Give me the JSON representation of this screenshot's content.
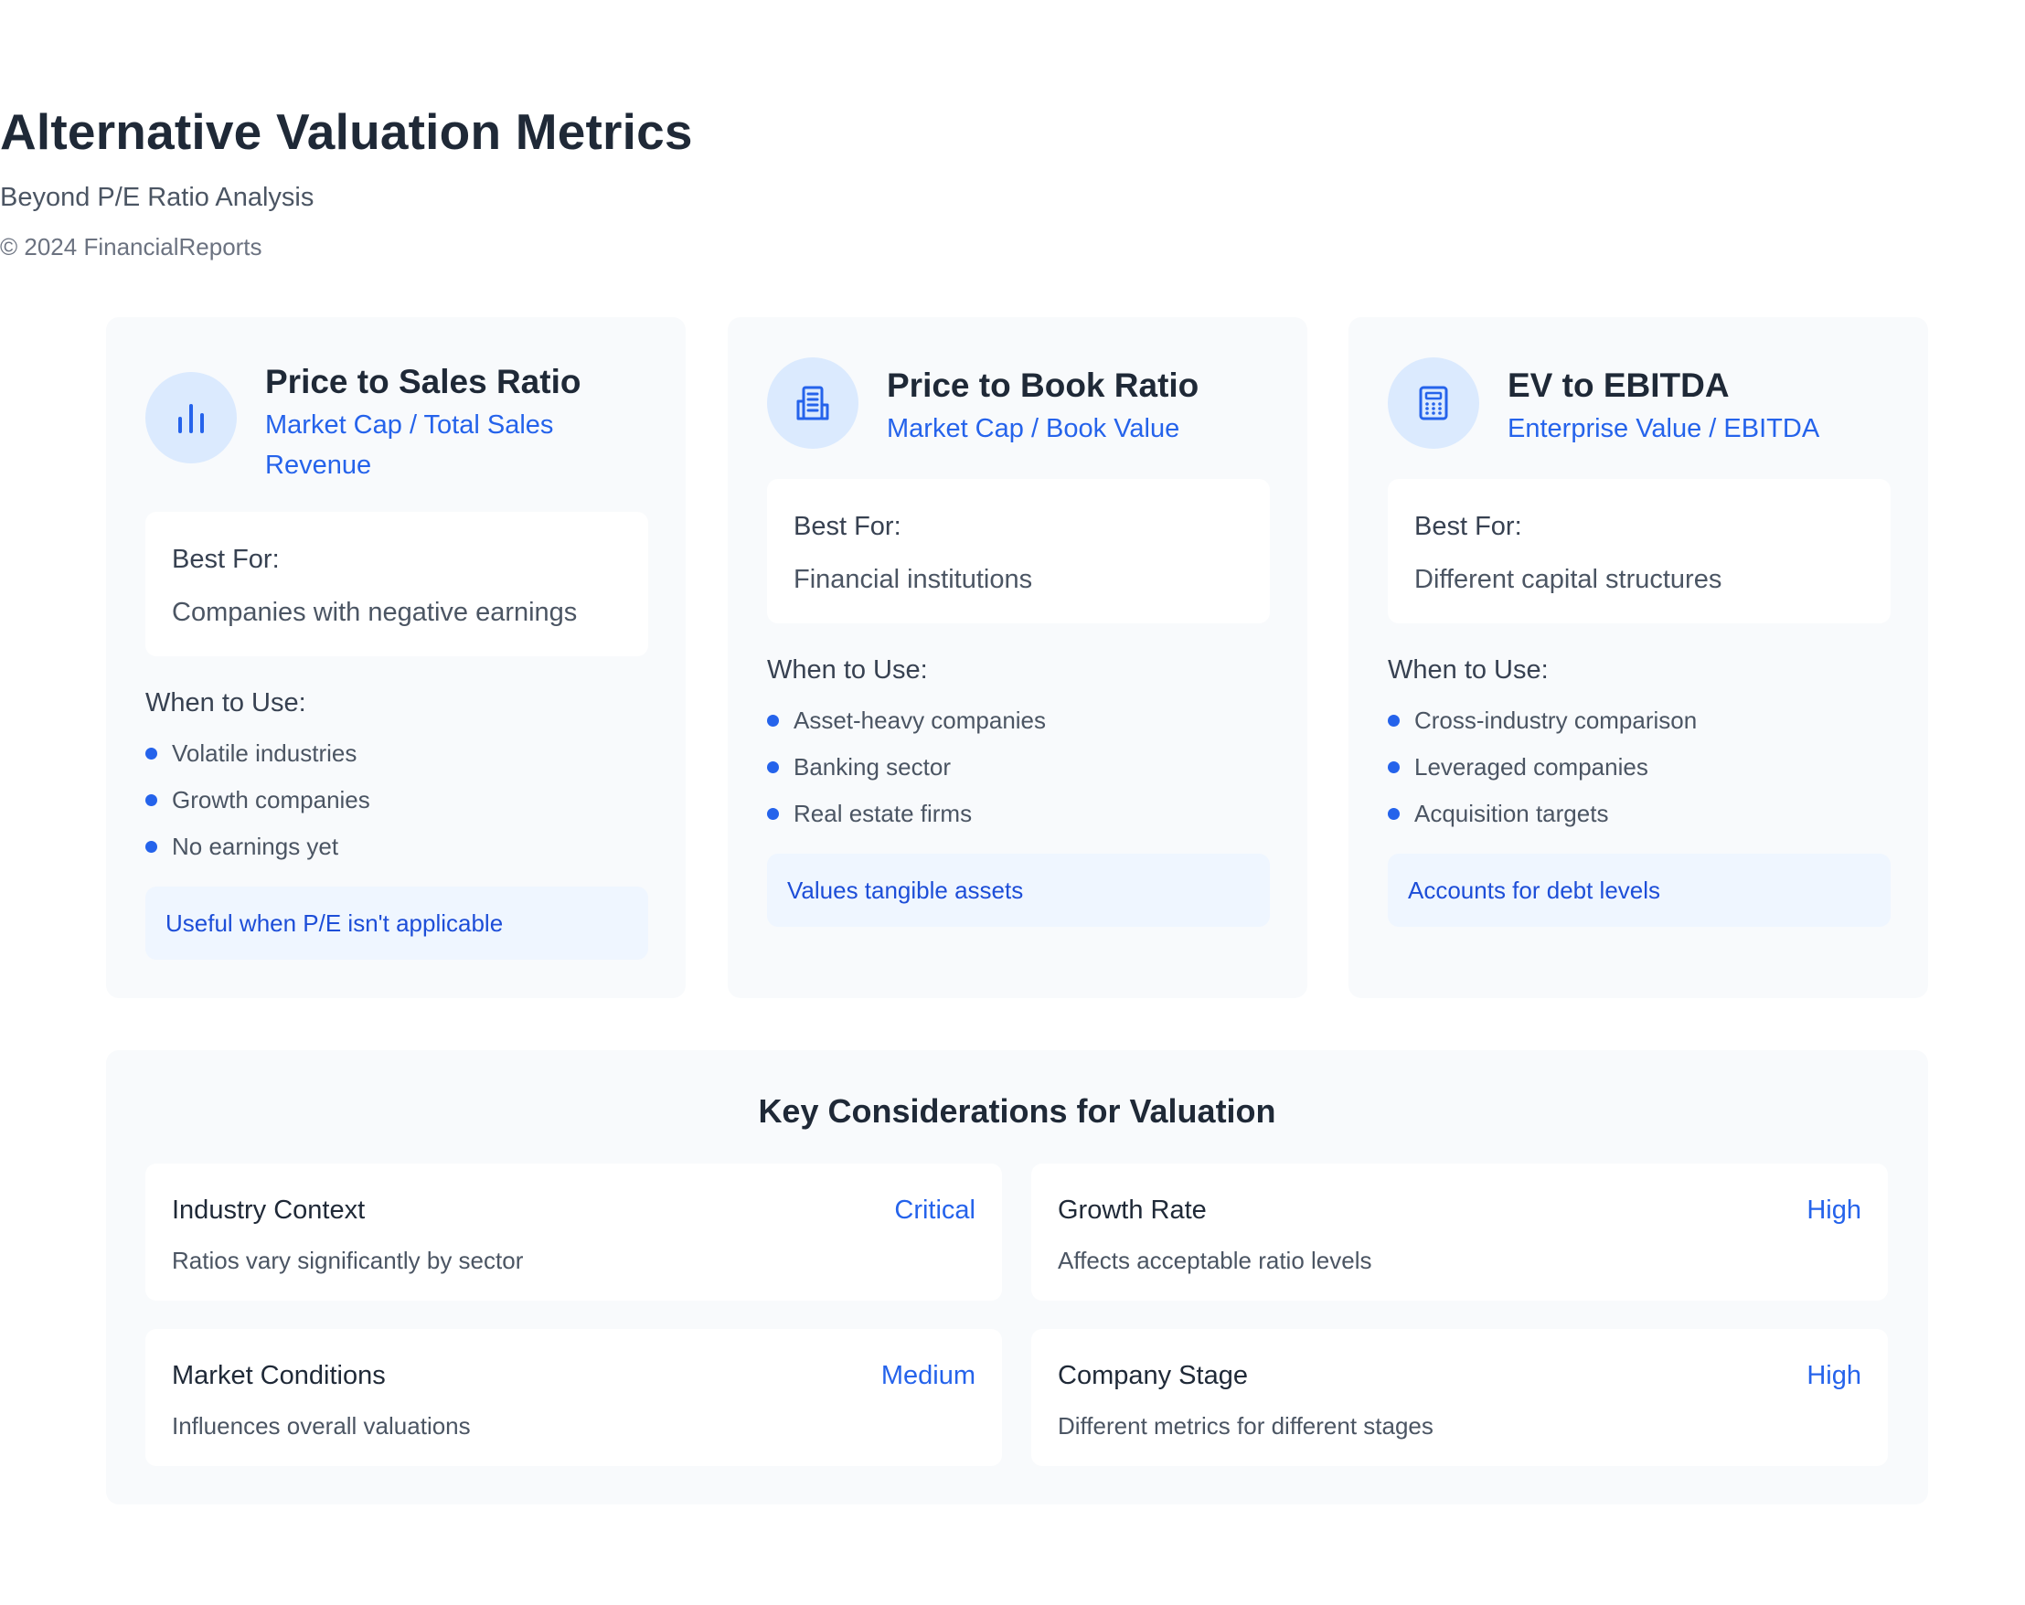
{
  "header": {
    "title": "Alternative Valuation Metrics",
    "subtitle": "Beyond P/E Ratio Analysis",
    "copyright": "© 2024 FinancialReports"
  },
  "metrics": [
    {
      "icon": "bar-chart-icon",
      "title": "Price to Sales Ratio",
      "formula": "Market Cap / Total Sales Revenue",
      "best_for_label": "Best For:",
      "best_for": "Companies with negative earnings",
      "when_label": "When to Use:",
      "uses": [
        "Volatile industries",
        "Growth companies",
        "No earnings yet"
      ],
      "note": "Useful when P/E isn't applicable"
    },
    {
      "icon": "building-icon",
      "title": "Price to Book Ratio",
      "formula": "Market Cap / Book Value",
      "best_for_label": "Best For:",
      "best_for": "Financial institutions",
      "when_label": "When to Use:",
      "uses": [
        "Asset-heavy companies",
        "Banking sector",
        "Real estate firms"
      ],
      "note": "Values tangible assets"
    },
    {
      "icon": "calculator-icon",
      "title": "EV to EBITDA",
      "formula": "Enterprise Value / EBITDA",
      "best_for_label": "Best For:",
      "best_for": "Different capital structures",
      "when_label": "When to Use:",
      "uses": [
        "Cross-industry comparison",
        "Leveraged companies",
        "Acquisition targets"
      ],
      "note": "Accounts for debt levels"
    }
  ],
  "considerations": {
    "title": "Key Considerations for Valuation",
    "items": [
      {
        "name": "Industry Context",
        "level": "Critical",
        "desc": "Ratios vary significantly by sector"
      },
      {
        "name": "Growth Rate",
        "level": "High",
        "desc": "Affects acceptable ratio levels"
      },
      {
        "name": "Market Conditions",
        "level": "Medium",
        "desc": "Influences overall valuations"
      },
      {
        "name": "Company Stage",
        "level": "High",
        "desc": "Different metrics for different stages"
      }
    ]
  },
  "colors": {
    "accent": "#2563eb",
    "card_bg": "#f8fafc",
    "icon_bg": "#dbeafe",
    "note_bg": "#eff6ff",
    "text": "#1f2937"
  }
}
